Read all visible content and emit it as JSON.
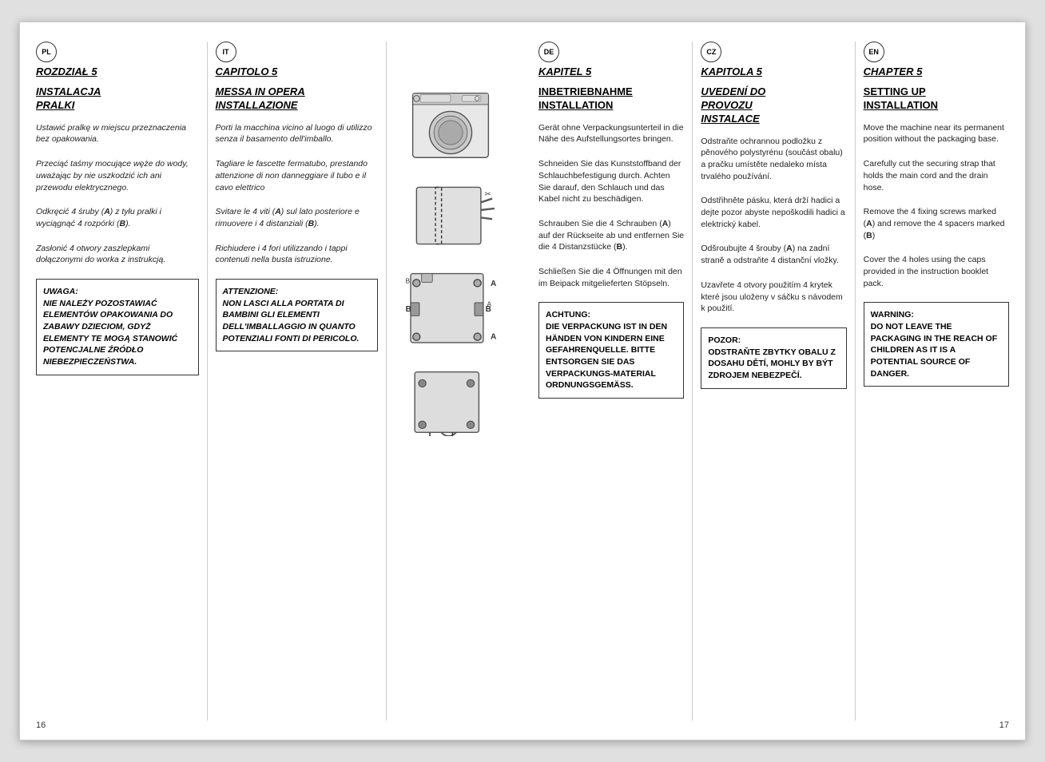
{
  "leftPage": {
    "pageNumber": "16",
    "columns": {
      "pl": {
        "lang": "PL",
        "chapter": "ROZDZIAŁ 5",
        "title": "INSTALACJA\nPRALKI",
        "instructions": [
          "Ustawić pralkę w miejscu przeznaczenia bez opakowania.",
          "Przeciąć taśmy mocujące węże do wody, uważając by nie uszkodzić ich ani przewodu elektrycznego.",
          "Odkręcić 4 śruby (A) z tyłu pralki i wyciągnąć 4 rozpórki (B).",
          "Zasłonić  4 otwory zaszlepkami dołączonymi do worka z instrukcją."
        ],
        "warning": {
          "title": "UWAGA:\nNIE NALEŻY POZOSTAWIAĆ ELEMENTÓW OPAKOWANIA DO ZABAWY DZIECIOM, GDYŻ ELEMENTY TE MOGĄ STANOWIĆ POTENCJALNE ŹRÓDŁO NIEBEZPIECZEŃSTWA."
        }
      },
      "it": {
        "lang": "IT",
        "chapter": "CAPITOLO 5",
        "title": "MESSA IN OPERA\nINSTALLAZIONE",
        "instructions": [
          "Porti la macchina vicino al luogo di utilizzo senza il basamento dell'imballo.",
          "Tagliare le fascette fermatubo, prestando attenzione di non danneggiare il tubo e il cavo elettrico",
          "Svitare le 4 viti (A) sul lato posteriore e rimuovere i 4 distanziali (B).",
          "Richiudere i 4 fori utilizzando i tappi contenuti nella busta istruzione."
        ],
        "warning": {
          "title": "ATTENZIONE:\nNON LASCI ALLA PORTATA DI BAMBINI GLI ELEMENTI DELL'IMBALLAGGIO IN QUANTO POTENZIALI FONTI DI PERICOLO."
        }
      }
    }
  },
  "rightPage": {
    "pageNumber": "17",
    "columns": {
      "de": {
        "lang": "DE",
        "chapter": "KAPITEL 5",
        "title": "INBETRIEBNAHME\nINSTALLATION",
        "instructions": [
          "Gerät ohne Verpackungsunterteil in die Nähe des Aufstellungsortes bringen.",
          "Schneiden Sie das Kunststoffband der Schlauchbefestigung durch. Achten Sie darauf, den Schlauch und das Kabel nicht zu beschädigen.",
          "Schrauben Sie die 4 Schrauben (A) auf der Rückseite ab und entfernen Sie die 4 Distanzstücke (B).",
          "Schließen Sie die 4 Öffnungen mit den im Beipack mitgelieferten Stöpseln."
        ],
        "warning": {
          "title": "ACHTUNG:\nDIE VERPACKUNG IST IN DEN HÄNDEN VON KINDERN EINE GEFAHRENQUELLE. BITTE ENTSORGEN SIE DAS VERPACKUNGS-MATERIAL ORDNUNGSGEMÄSS."
        }
      },
      "cz": {
        "lang": "CZ",
        "chapter": "KAPITOLA 5",
        "title": "UVEDENÍ DO\nPROVOZU\nINSTALACE",
        "instructions": [
          "Odstraňte ochrannou podložku z pěnového polystyrénu (součást obalu) a pračku umístěte nedaleko místa trvalého používání.",
          "Odstřihněte pásku, která drží hadici a dejte pozor abyste nepoškodili hadici a elektrický kabel.",
          "Odšroubujte 4 šrouby (A) na zadní straně a odstraňte 4 distanční vložky.",
          "Uzavřete 4 otvory použitím 4 krytek které jsou uloženy v sáčku s návodem k použití."
        ],
        "warning": {
          "title": "POZOR:\nODSTRAŇTE ZBYTKY OBALU Z DOSAHU DĚTÍ, MOHLY BY BÝT ZDROJEM NEBEZPEČÍ."
        }
      },
      "en": {
        "lang": "EN",
        "chapter": "CHAPTER 5",
        "title": "SETTING UP\nINSTALLATION",
        "instructions": [
          "Move the machine near its permanent position without the packaging base.",
          "Carefully cut the securing strap that holds the main cord and the drain hose.",
          "Remove the 4 fixing screws marked (A) and remove the 4 spacers marked (B)",
          "Cover the 4 holes using the caps provided in the instruction booklet pack."
        ],
        "warning": {
          "title": "WARNING:\nDO NOT LEAVE THE PACKAGING IN THE REACH OF CHILDREN AS IT IS A POTENTIAL SOURCE OF DANGER."
        }
      }
    }
  }
}
